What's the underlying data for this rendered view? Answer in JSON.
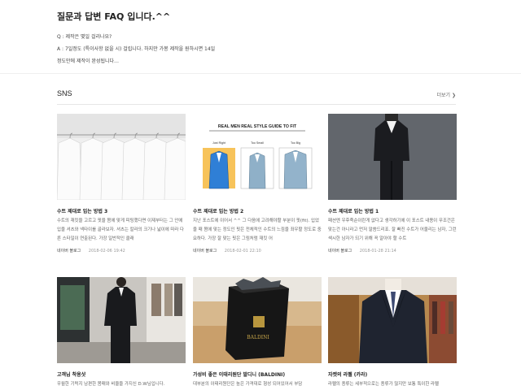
{
  "faq": {
    "title": "질문과 답변 FAQ 입니다.^^",
    "lines": [
      "Q : 제작은 몇일 걸리나요?",
      "A : 7일정도 (특이사항 없을 시) 걸립니다. 하지만 가봉 제작을 원하시면 14일",
      "정도만에 제작이 완성됩니다…"
    ]
  },
  "sns": {
    "title": "SNS",
    "more_label": "더보기 ❯"
  },
  "cards": [
    {
      "title": "수트 제대로 입는 방법 3",
      "excerpt": "수트의 재킷을 고르고 핏을 몸에 맞게 피팅했다면 이제부터는 그 안에 입을 셔츠와 넥타이를 골라보자. 셔츠는 칼라의 크기나 넓이에 따라 다른 스타일이 연출된다. 가장 일반적인 클래",
      "source": "네이버 블로그",
      "date": "2018-02-06 19:42"
    },
    {
      "title": "수트 제대로 입는 방법 2",
      "excerpt": "지난 포스트에 이어서 ^^ 그 다음에 고려해야할 부분이 핏(fit). 입었을 때 몸에 맞는 정도인 핏은 전체적인 수트의 느낌을 좌우할 정도로 중요하다. 가장 잘 맞는 핏은 그림처럼 재킷 어",
      "source": "네이버 블로그",
      "date": "2018-02-01 22:10"
    },
    {
      "title": "수트 제대로 입는 방법 1",
      "excerpt": "패션엔 우후죽순이란게 없다고 생각하기에 이 포스트 내용이 무조건은 맞는건 아니라고 먼저 말씀드리죠. 잘 빠진 수트가 어울리는 남자, 그런 섹시한 남자가 되기 위해 꼭 알아야 할 수트",
      "source": "네이버 블로그",
      "date": "2018-01-28 21:14"
    },
    {
      "title": "고객님 착용샷",
      "excerpt": "우월한 기럭지 남편한 몸매와 비율을 가지신 D.W님입니다.",
      "source": "",
      "date": ""
    },
    {
      "title": "가성비 좋은 이태리원단 발디니 (BALDINI)",
      "excerpt": "대부분의 이태리원단은 높은 가격대로 형성 되어있어서 부담",
      "source": "",
      "date": ""
    },
    {
      "title": "자켓의 라펠 (카라)",
      "excerpt": "라펠의 종류는 세부적으로는 종류가 많지만 보통 특이한 라펠",
      "source": "",
      "date": ""
    }
  ],
  "guide_image": {
    "heading": "REAL MEN REAL STYLE GUIDE TO FIT",
    "labels": [
      "Just Right",
      "Too Small",
      "Too Big"
    ]
  },
  "box_image": {
    "brand": "BALDINI"
  }
}
